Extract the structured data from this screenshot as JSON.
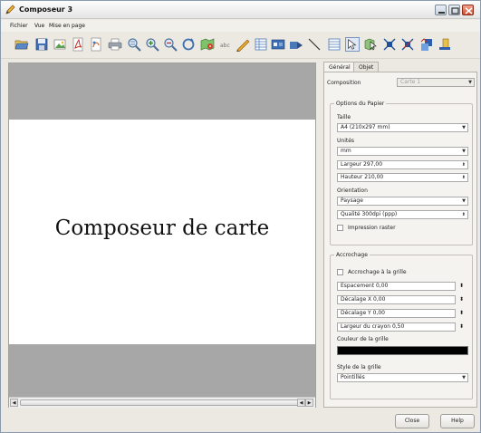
{
  "window": {
    "title": "Composeur 3"
  },
  "menu": [
    "Fichier",
    "Vue",
    "Mise en page"
  ],
  "toolbar_icons": [
    "open-icon",
    "save-icon",
    "export-image-icon",
    "export-pdf-icon",
    "export-svg-icon",
    "print-icon",
    "zoom-full-icon",
    "zoom-in-icon",
    "zoom-out-icon",
    "refresh-icon",
    "add-map-icon",
    "add-label-icon",
    "add-shape-icon",
    "add-table-icon",
    "add-legend-icon",
    "add-scalebar-icon",
    "add-arrow-icon",
    "add-attribute-table-icon",
    "select-icon",
    "move-content-icon",
    "group-icon",
    "ungroup-icon",
    "raise-icon",
    "lower-icon"
  ],
  "canvas": {
    "label": "Composeur de carte"
  },
  "panel": {
    "tabs": [
      "Général",
      "Objet"
    ],
    "composition_label": "Composition",
    "composition_value": "Carte 1",
    "paper_group": "Options du Papier",
    "taille_label": "Taille",
    "taille_value": "A4 (210x297 mm)",
    "unites_label": "Unités",
    "unites_value": "mm",
    "largeur": "Largeur 297,00",
    "hauteur": "Hauteur 210,00",
    "orientation_label": "Orientation",
    "orientation_value": "Paysage",
    "qualite": "Qualité 300dpi (ppp)",
    "impression_raster": "Impression raster",
    "accrochage_group": "Accrochage",
    "accrochage_grille": "Accrochage à la grille",
    "espacement": "Espacement 0,00",
    "decalage_x": "Décalage X 0,00",
    "decalage_y": "Décalage Y 0,00",
    "largeur_crayon": "Largeur du crayon 0,50",
    "couleur_grille_label": "Couleur de la grille",
    "grid_color": "#000000",
    "style_grille_label": "Style de la grille",
    "style_grille_value": "Pointillés"
  },
  "buttons": {
    "close": "Close",
    "help": "Help"
  }
}
